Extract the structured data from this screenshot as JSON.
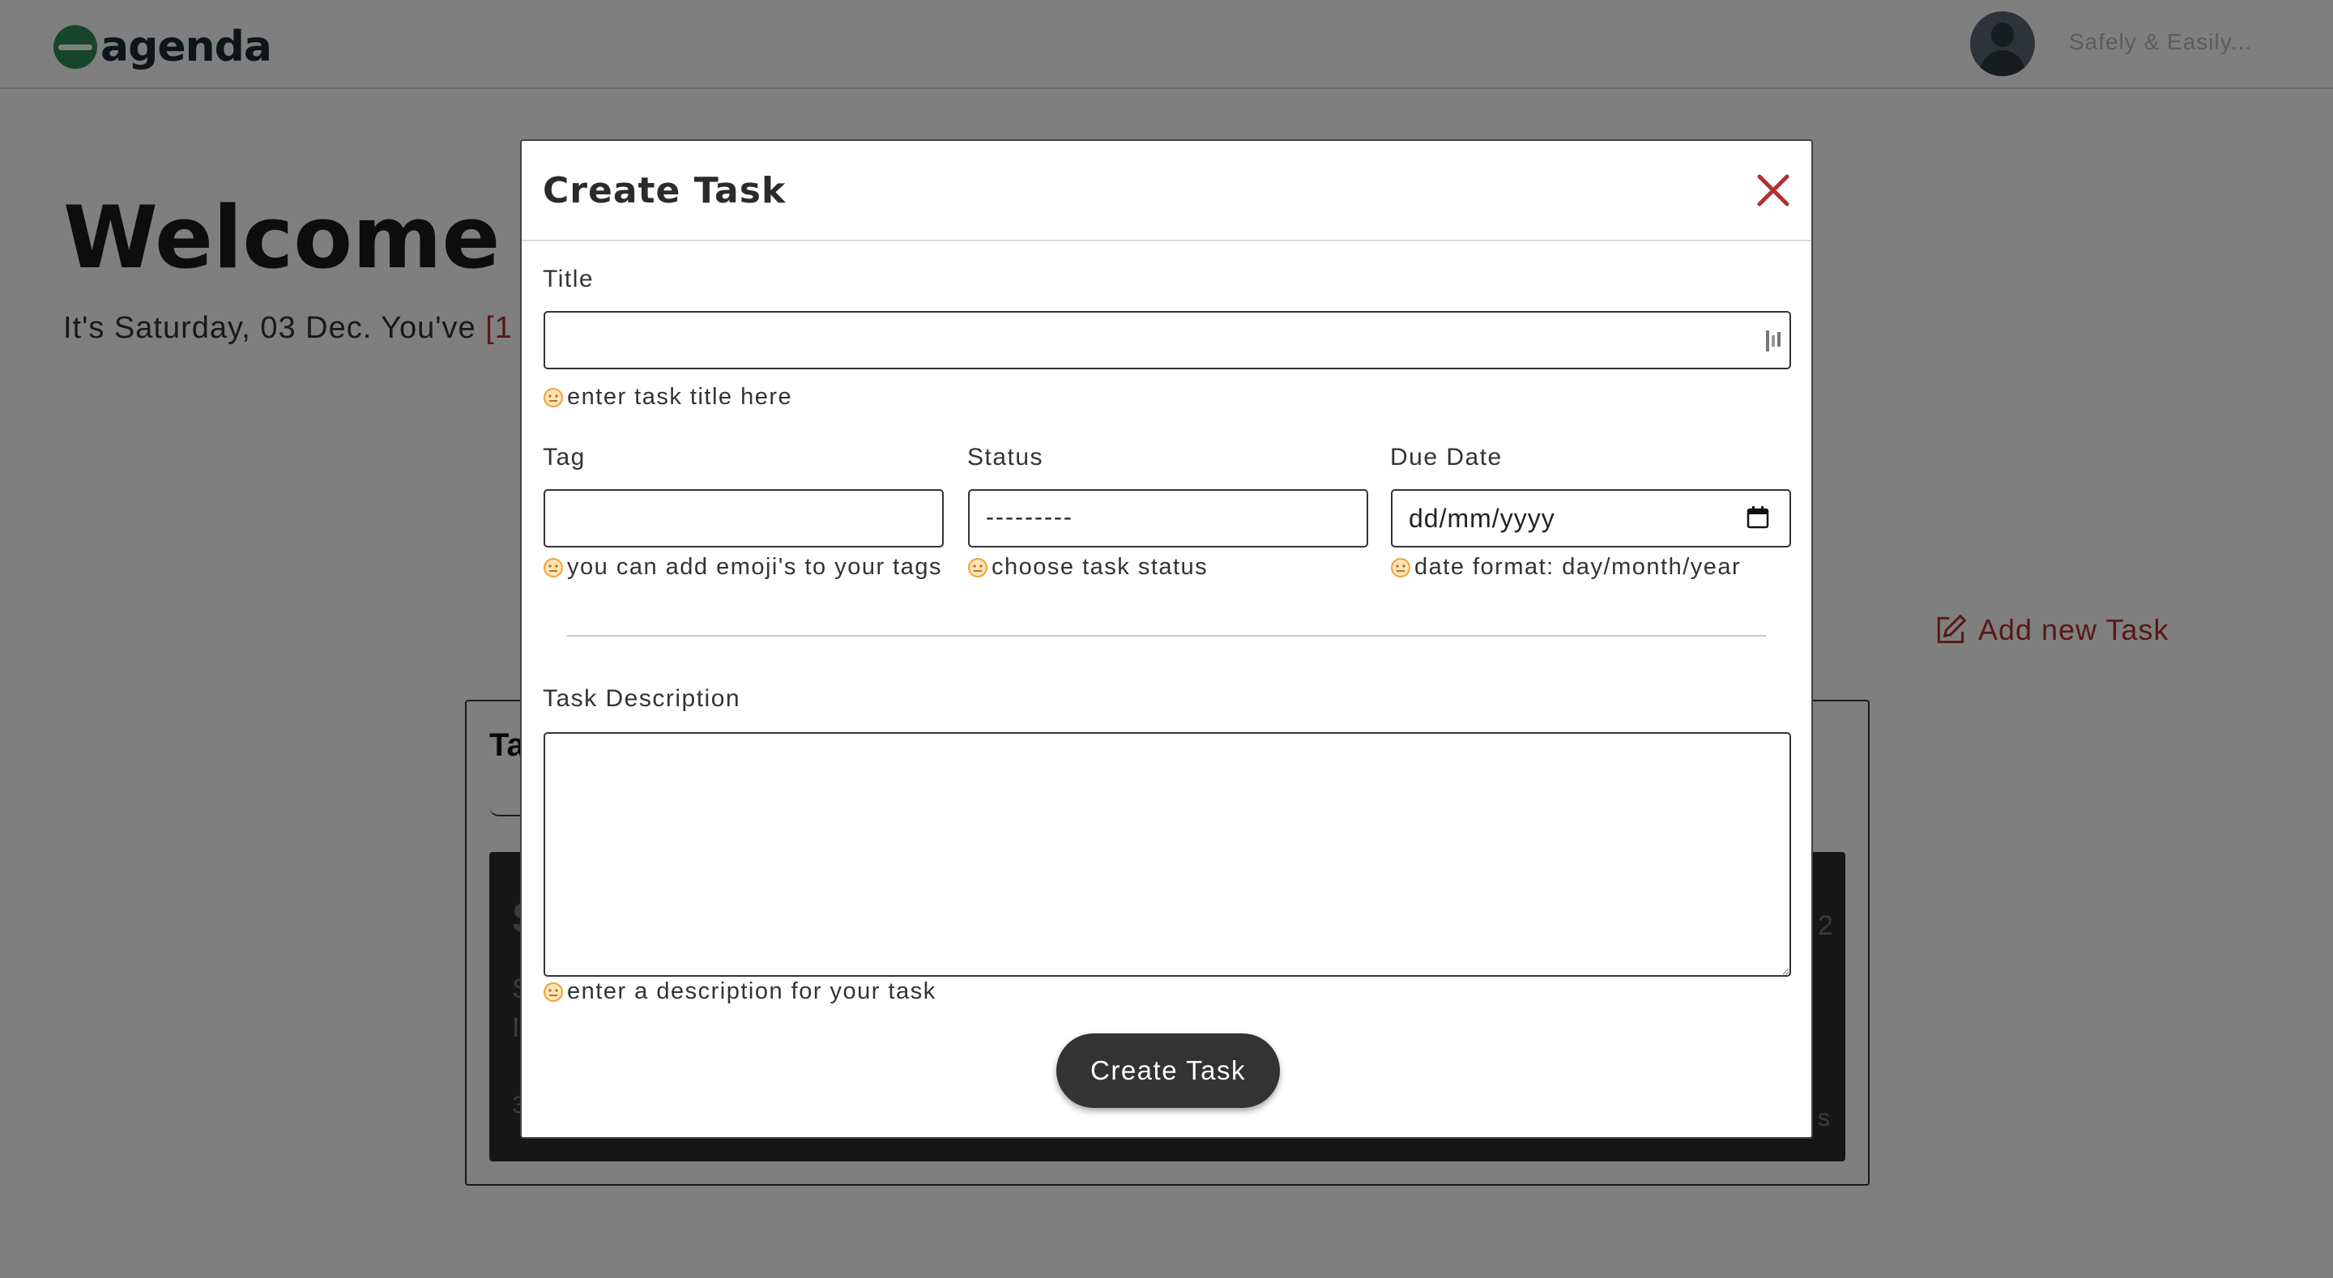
{
  "app": {
    "logo_text": "agenda",
    "tagline": "Safely & Easily..."
  },
  "page": {
    "welcome_text": "Welcome d",
    "subtitle_text": "It's Saturday, 03 Dec. You've ",
    "subtitle_accent": "[1",
    "add_task_label": "Add new Task",
    "tasks_heading": "Ta",
    "task_ghost": {
      "g1": "S",
      "g2": "S",
      "g3": "I",
      "g4": "3",
      "g5": "2",
      "g6": "s"
    }
  },
  "modal": {
    "title": "Create Task",
    "title_field": {
      "label": "Title",
      "value": "",
      "hint": "enter task title here"
    },
    "tag_field": {
      "label": "Tag",
      "value": "",
      "hint": "you can add emoji's to your tags"
    },
    "status_field": {
      "label": "Status",
      "selected": "---------",
      "hint": "choose task status"
    },
    "due_date_field": {
      "label": "Due Date",
      "placeholder": "dd/mm/yyyy",
      "hint": "date format: day/month/year"
    },
    "description_field": {
      "label": "Task Description",
      "value": "",
      "hint": "enter a description for your task"
    },
    "submit_label": "Create Task"
  },
  "colors": {
    "accent_red": "#b03030",
    "brand_green": "#2e8b57",
    "button_dark": "#333333",
    "hint_emoji": "#f2a13a"
  },
  "icons": [
    "close-icon",
    "smiley-icon",
    "calendar-icon",
    "edit-icon",
    "password-manager-icon"
  ]
}
